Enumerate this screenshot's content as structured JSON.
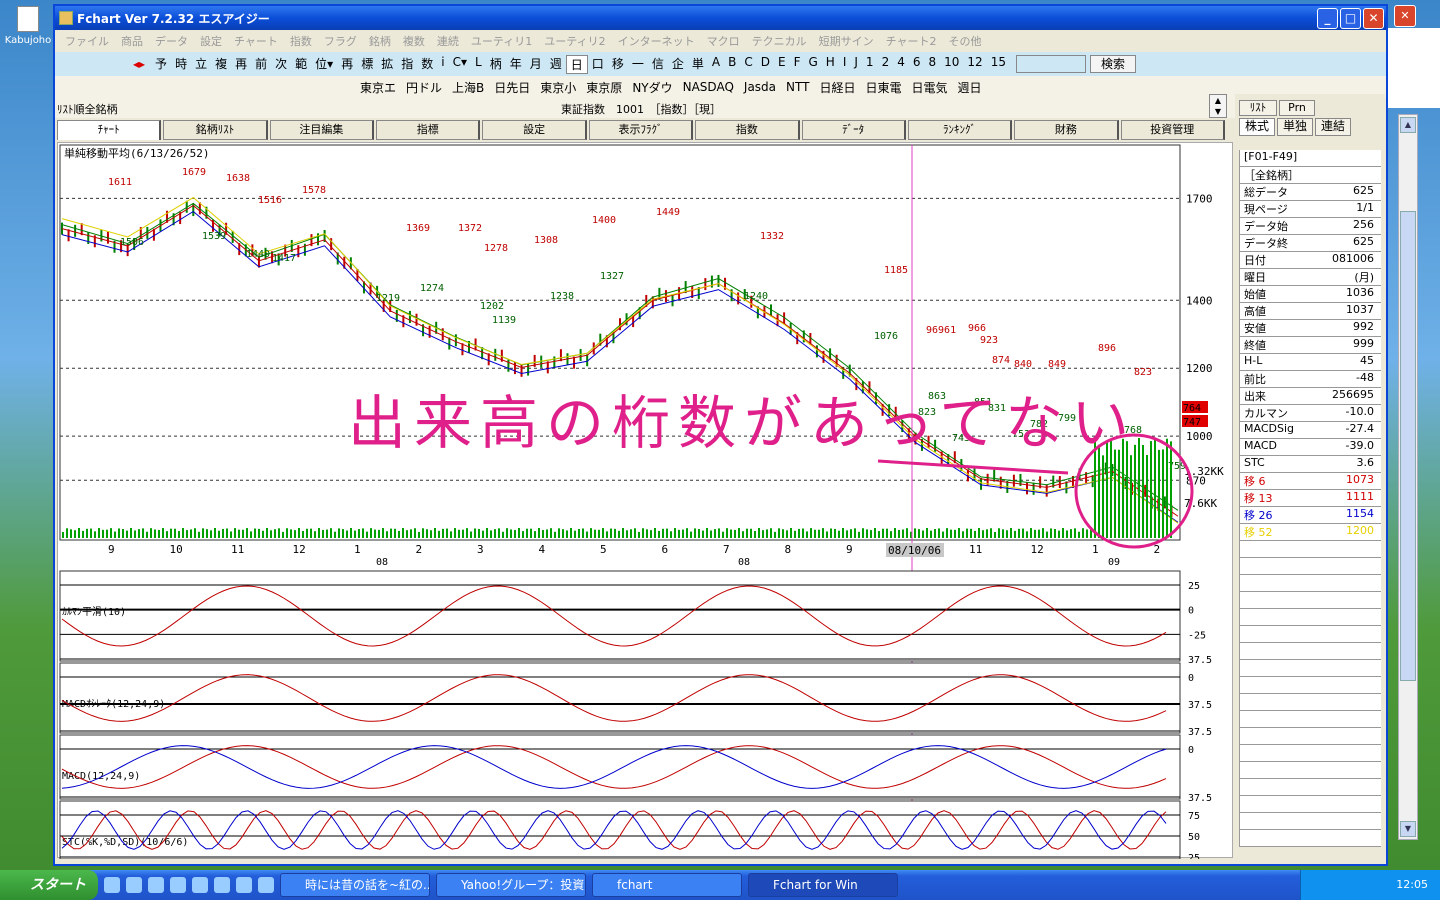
{
  "desktop": {
    "icon_label": "Kabujoho"
  },
  "window": {
    "title": "Fchart Ver 7.2.32 エスアイジー",
    "min": "_",
    "max": "□",
    "close": "✕"
  },
  "menu": [
    "ファイル",
    "商品",
    "データ",
    "設定",
    "チャート",
    "指数",
    "フラグ",
    "銘柄",
    "複数",
    "連続",
    "ユーティリ1",
    "ユーティリ2",
    "インターネット",
    "マクロ",
    "テクニカル",
    "短期サイン",
    "チャート2",
    "その他"
  ],
  "toolbar1": {
    "items": [
      "予",
      "時",
      "立",
      "複",
      "再",
      "前",
      "次",
      "範",
      "位▾",
      "再",
      "標",
      "拡",
      "指",
      "数",
      "i",
      "C▾",
      "L",
      "柄",
      "年",
      "月",
      "週",
      "日",
      "口",
      "移",
      "一",
      "信",
      "企",
      "単",
      "A",
      "B",
      "C",
      "D",
      "E",
      "F",
      "G",
      "H",
      "I",
      "J",
      "1",
      "2",
      "4",
      "6",
      "8",
      "10",
      "12",
      "15"
    ],
    "selected": "日",
    "search_label": "検索"
  },
  "toolbar2": [
    "東京エ",
    "円ドル",
    "上海B",
    "日先日",
    "東京小",
    "東京原",
    "NYダウ",
    "NASDAQ",
    "Jasda",
    "NTT",
    "日経日",
    "日東電",
    "日電気",
    "週日"
  ],
  "header": {
    "left": "ﾘｽﾄ順全銘柄",
    "center": "東証指数　1001　［指数］［現］"
  },
  "tabs": [
    "ﾁｬｰﾄ",
    "銘柄ﾘｽﾄ",
    "注目編集",
    "指標",
    "設定",
    "表示ﾌﾗｸﾞ",
    "指数",
    "ﾃﾞｰﾀ",
    "ﾗﾝｷﾝｸﾞ",
    "財務",
    "投資管理"
  ],
  "side": {
    "tabs_top": [
      "ﾘｽﾄ",
      "Prn"
    ],
    "tabs_bottom": [
      "株式",
      "単独",
      "連結"
    ],
    "rows": [
      {
        "l": "[F01-F49]",
        "v": ""
      },
      {
        "l": "［全銘柄］",
        "v": ""
      },
      {
        "l": "総データ",
        "v": "625"
      },
      {
        "l": "現ページ",
        "v": "1/1"
      },
      {
        "l": "データ始",
        "v": "256"
      },
      {
        "l": "データ終",
        "v": "625"
      },
      {
        "l": "日付",
        "v": "081006"
      },
      {
        "l": "曜日",
        "v": "(月)"
      },
      {
        "l": "始値",
        "v": "1036"
      },
      {
        "l": "高値",
        "v": "1037"
      },
      {
        "l": "安値",
        "v": "992"
      },
      {
        "l": "終値",
        "v": "999"
      },
      {
        "l": "H-L",
        "v": "45"
      },
      {
        "l": "前比",
        "v": "-48"
      },
      {
        "l": "出来",
        "v": "256695"
      },
      {
        "l": "カルマン",
        "v": "-10.0"
      },
      {
        "l": "MACDSig",
        "v": "-27.4"
      },
      {
        "l": "MACD",
        "v": "-39.0"
      },
      {
        "l": "STC",
        "v": "3.6"
      },
      {
        "l": "移 6",
        "v": "1073",
        "c": "red"
      },
      {
        "l": "移 13",
        "v": "1111",
        "c": "red"
      },
      {
        "l": "移 26",
        "v": "1154",
        "c": "blue"
      },
      {
        "l": "移 52",
        "v": "1200",
        "c": "yel"
      }
    ]
  },
  "chart": {
    "title": "単純移動平均(6/13/26/52)",
    "price_axis": [
      "1700",
      "1400",
      "1200",
      "1000",
      "870"
    ],
    "price_tags": [
      "764",
      "747"
    ],
    "vol_axis": [
      "1.32KK",
      "7.6KK"
    ],
    "x_labels": [
      "9",
      "10",
      "11",
      "12",
      "1",
      "2",
      "3",
      "4",
      "5",
      "6",
      "7",
      "8",
      "9",
      "10",
      "11",
      "12",
      "1",
      "2"
    ],
    "year_labels": [
      "08",
      "08",
      "09"
    ],
    "cursor_date": "08/10/06",
    "annotations_high": [
      "1611",
      "1679",
      "1638",
      "1516",
      "1578",
      "1369",
      "1372",
      "1278",
      "1308",
      "1400",
      "1449",
      "1332",
      "1185",
      "96961",
      "966",
      "923",
      "874",
      "840",
      "849",
      "896",
      "823"
    ],
    "annotations_low": [
      "1506",
      "1539",
      "1440",
      "1417",
      "1219",
      "1274",
      "1202",
      "1139",
      "1238",
      "1327",
      "1240",
      "1076",
      "863",
      "823",
      "851",
      "831",
      "743",
      "753",
      "782",
      "799",
      "768",
      "759"
    ],
    "handwriting": "出来高の桁数があってない",
    "kalman": {
      "label": "ｶﾙﾏﾝ平滑(10)",
      "axis": [
        "25",
        "0",
        "-25",
        "37.5"
      ]
    },
    "macd_osc": {
      "label": "MACDｵｼﾚｰﾀ(12,24,9)",
      "axis": [
        "0",
        "37.5",
        "37.5"
      ]
    },
    "macd": {
      "label": "MACD(12,24,9)",
      "axis": [
        "0",
        "37.5"
      ]
    },
    "stc": {
      "label": "STC(%K,%D,SD)(10/6/6)",
      "axis": [
        "75",
        "50",
        "25"
      ]
    }
  },
  "chart_data": {
    "type": "line",
    "title": "単純移動平均(6/13/26/52)",
    "x": [
      "9",
      "10",
      "11",
      "12",
      "1",
      "2",
      "3",
      "4",
      "5",
      "6",
      "7",
      "8",
      "9",
      "10",
      "11",
      "12",
      "1",
      "2"
    ],
    "series": [
      {
        "name": "",
        "values": [
          1611,
          1560,
          1679,
          1516,
          1578,
          1369,
          1278,
          1202,
          1238,
          1400,
          1449,
          1332,
          1185,
          999,
          874,
          849,
          896,
          764
        ]
      }
    ],
    "ylim": [
      700,
      1760
    ],
    "grid": true
  },
  "taskbar": {
    "start": "スタート",
    "tasks": [
      "時には昔の話を~紅の...",
      "Yahoo!グループ：投資...",
      "fchart",
      "Fchart for Win"
    ],
    "clock": "12:05"
  }
}
